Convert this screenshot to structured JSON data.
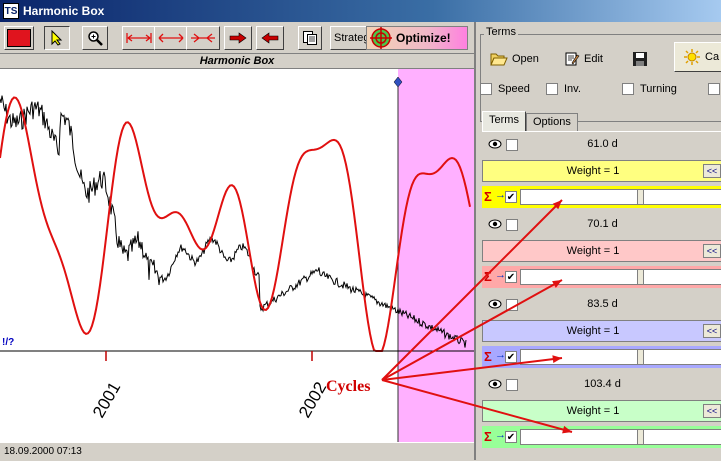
{
  "window": {
    "title": "Harmonic Box",
    "icon_label": "TS"
  },
  "toolbar": {
    "strategy_label": "Strategy",
    "optimize_label": "Optimize!",
    "color_swatch": "#e0141e"
  },
  "chart": {
    "title": "Harmonic Box",
    "info_label": "!/?",
    "year_labels": [
      "2001",
      "2002"
    ],
    "annotation": "Cycles"
  },
  "status": {
    "datetime": "18.09.2000  07:13"
  },
  "panel": {
    "group_label": "Terms",
    "open_label": "Open",
    "edit_label": "Edit",
    "calc_label": "Ca",
    "options": [
      {
        "label": "Speed",
        "checked": false
      },
      {
        "label": "Inv.",
        "checked": false
      },
      {
        "label": "Turning",
        "checked": false
      }
    ],
    "tabs": [
      {
        "label": "Terms",
        "active": true
      },
      {
        "label": "Options",
        "active": false
      }
    ]
  },
  "terms": [
    {
      "period": "61.0 d",
      "weight": "Weight = 1",
      "color": "#ffff00",
      "header_color": "#ffff80",
      "slider": 0.58
    },
    {
      "period": "70.1 d",
      "weight": "Weight = 1",
      "color": "#ffa8a8",
      "header_color": "#ffc8c8",
      "slider": 0.58
    },
    {
      "period": "83.5 d",
      "weight": "Weight = 1",
      "color": "#a8a8ff",
      "header_color": "#c8c8ff",
      "slider": 0.58
    },
    {
      "period": "103.4 d",
      "weight": "Weight = 1",
      "color": "#98ff98",
      "header_color": "#c8ffc8",
      "slider": 0.58
    }
  ],
  "collapse_label": "<<",
  "chart_colors": {
    "price": "#000000",
    "cycle": "#e01010",
    "forecast_zone": "#ffb0ff"
  }
}
